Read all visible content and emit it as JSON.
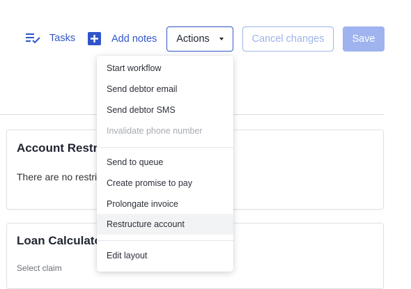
{
  "toolbar": {
    "tasks_label": "Tasks",
    "add_notes_label": "Add notes",
    "actions_label": "Actions",
    "cancel_label": "Cancel changes",
    "save_label": "Save"
  },
  "actions_menu": {
    "items": [
      {
        "label": "Start workflow",
        "disabled": false
      },
      {
        "label": "Send debtor email",
        "disabled": false
      },
      {
        "label": "Send debtor SMS",
        "disabled": false
      },
      {
        "label": "Invalidate phone number",
        "disabled": true
      },
      {
        "label": "Send to queue",
        "disabled": false
      },
      {
        "label": "Create promise to pay",
        "disabled": false
      },
      {
        "label": "Prolongate invoice",
        "disabled": false
      },
      {
        "label": "Restructure account",
        "disabled": false,
        "highlighted": true
      },
      {
        "label": "Edit layout",
        "disabled": false
      }
    ]
  },
  "cards": {
    "account_restructure": {
      "title": "Account Restru",
      "text": "There are no restri"
    },
    "loan_calculator": {
      "title": "Loan Calculato",
      "subtitle": "Select claim"
    }
  },
  "colors": {
    "primary": "#2f55c8",
    "primary_disabled": "#9fb4ef",
    "menu_highlight": "#f2f3f5"
  },
  "icons": {
    "tasks": "checklist-icon",
    "add_notes": "add-box-icon",
    "actions_caret": "caret-down-icon"
  }
}
